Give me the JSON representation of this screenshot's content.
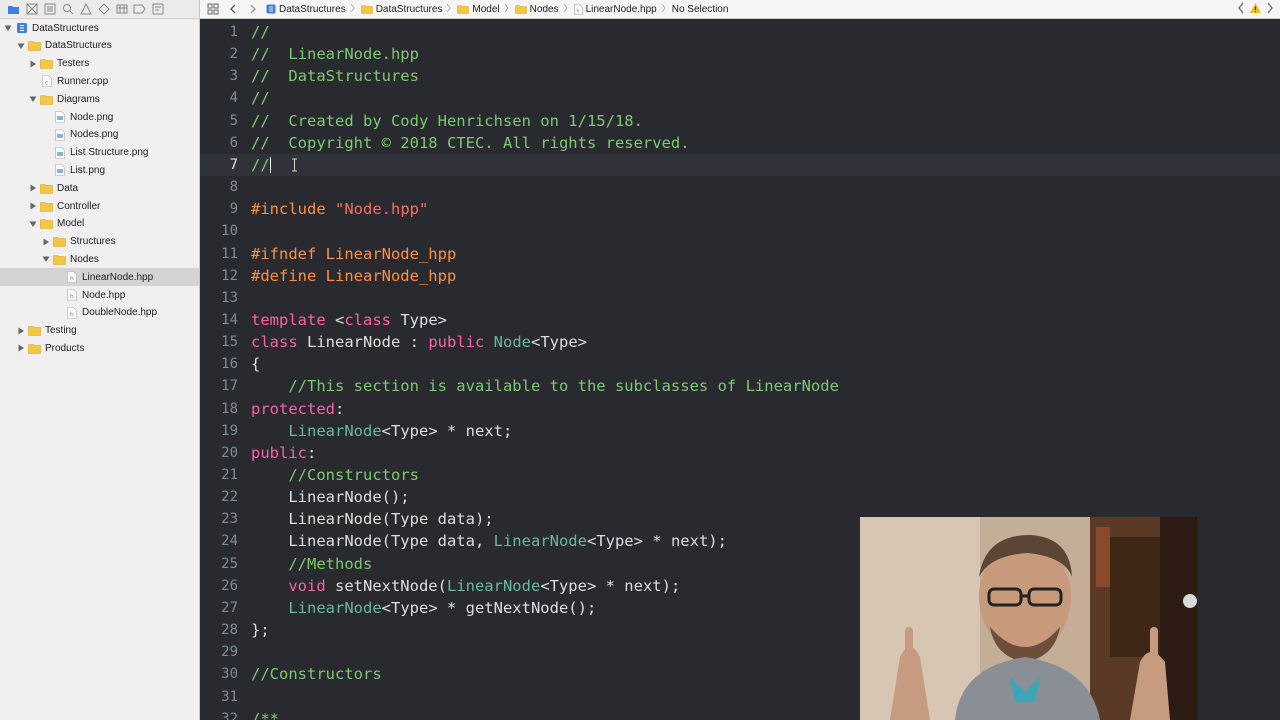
{
  "navigator": {
    "tree": [
      {
        "label": "DataStructures",
        "level": 0,
        "kind": "project",
        "disclosure": "open"
      },
      {
        "label": "DataStructures",
        "level": 1,
        "kind": "folder",
        "disclosure": "open"
      },
      {
        "label": "Testers",
        "level": 2,
        "kind": "folder",
        "disclosure": "closed"
      },
      {
        "label": "Runner.cpp",
        "level": 2,
        "kind": "cpp-file",
        "disclosure": "none"
      },
      {
        "label": "Diagrams",
        "level": 2,
        "kind": "folder",
        "disclosure": "open"
      },
      {
        "label": "Node.png",
        "level": 3,
        "kind": "image-file",
        "disclosure": "none"
      },
      {
        "label": "Nodes.png",
        "level": 3,
        "kind": "image-file",
        "disclosure": "none"
      },
      {
        "label": "List Structure.png",
        "level": 3,
        "kind": "image-file",
        "disclosure": "none"
      },
      {
        "label": "List.png",
        "level": 3,
        "kind": "image-file",
        "disclosure": "none"
      },
      {
        "label": "Data",
        "level": 2,
        "kind": "folder",
        "disclosure": "closed"
      },
      {
        "label": "Controller",
        "level": 2,
        "kind": "folder",
        "disclosure": "closed"
      },
      {
        "label": "Model",
        "level": 2,
        "kind": "folder",
        "disclosure": "open"
      },
      {
        "label": "Structures",
        "level": 3,
        "kind": "folder",
        "disclosure": "closed"
      },
      {
        "label": "Nodes",
        "level": 3,
        "kind": "folder",
        "disclosure": "open"
      },
      {
        "label": "LinearNode.hpp",
        "level": 4,
        "kind": "header-file",
        "disclosure": "none",
        "selected": true
      },
      {
        "label": "Node.hpp",
        "level": 4,
        "kind": "header-file",
        "disclosure": "none"
      },
      {
        "label": "DoubleNode.hpp",
        "level": 4,
        "kind": "header-file",
        "disclosure": "none"
      },
      {
        "label": "Testing",
        "level": 1,
        "kind": "folder",
        "disclosure": "closed"
      },
      {
        "label": "Products",
        "level": 1,
        "kind": "folder",
        "disclosure": "closed"
      }
    ]
  },
  "breadcrumb": [
    {
      "label": "DataStructures",
      "icon": "project-icon"
    },
    {
      "label": "DataStructures",
      "icon": "folder-icon"
    },
    {
      "label": "Model",
      "icon": "folder-icon"
    },
    {
      "label": "Nodes",
      "icon": "folder-icon"
    },
    {
      "label": "LinearNode.hpp",
      "icon": "header-file-icon"
    },
    {
      "label": "No Selection",
      "icon": ""
    }
  ],
  "editor": {
    "current_line": 7,
    "lines": [
      {
        "n": "1",
        "tokens": [
          {
            "t": "//",
            "c": "com"
          }
        ]
      },
      {
        "n": "2",
        "tokens": [
          {
            "t": "//  LinearNode.hpp",
            "c": "com"
          }
        ]
      },
      {
        "n": "3",
        "tokens": [
          {
            "t": "//  DataStructures",
            "c": "com"
          }
        ]
      },
      {
        "n": "4",
        "tokens": [
          {
            "t": "//",
            "c": "com"
          }
        ]
      },
      {
        "n": "5",
        "tokens": [
          {
            "t": "//  Created by Cody Henrichsen on 1/15/18.",
            "c": "com"
          }
        ]
      },
      {
        "n": "6",
        "tokens": [
          {
            "t": "//  Copyright © 2018 CTEC. All rights reserved.",
            "c": "com"
          }
        ]
      },
      {
        "n": "7",
        "tokens": [
          {
            "t": "//",
            "c": "com"
          }
        ]
      },
      {
        "n": "8",
        "tokens": []
      },
      {
        "n": "9",
        "tokens": [
          {
            "t": "#include ",
            "c": "pre"
          },
          {
            "t": "\"Node.hpp\"",
            "c": "str"
          }
        ]
      },
      {
        "n": "10",
        "tokens": []
      },
      {
        "n": "11",
        "tokens": [
          {
            "t": "#ifndef LinearNode_hpp",
            "c": "pre"
          }
        ]
      },
      {
        "n": "12",
        "tokens": [
          {
            "t": "#define LinearNode_hpp",
            "c": "pre"
          }
        ]
      },
      {
        "n": "13",
        "tokens": []
      },
      {
        "n": "14",
        "tokens": [
          {
            "t": "template",
            "c": "kw"
          },
          {
            "t": " <",
            "c": "plain"
          },
          {
            "t": "class",
            "c": "kw"
          },
          {
            "t": " Type>",
            "c": "plain"
          }
        ]
      },
      {
        "n": "15",
        "tokens": [
          {
            "t": "class",
            "c": "kw"
          },
          {
            "t": " LinearNode : ",
            "c": "plain"
          },
          {
            "t": "public",
            "c": "kw"
          },
          {
            "t": " ",
            "c": "plain"
          },
          {
            "t": "Node",
            "c": "type"
          },
          {
            "t": "<Type>",
            "c": "plain"
          }
        ]
      },
      {
        "n": "16",
        "tokens": [
          {
            "t": "{",
            "c": "plain"
          }
        ]
      },
      {
        "n": "17",
        "tokens": [
          {
            "t": "    //This section is available to the subclasses of LinearNode",
            "c": "com"
          }
        ]
      },
      {
        "n": "18",
        "tokens": [
          {
            "t": "protected",
            "c": "kw"
          },
          {
            "t": ":",
            "c": "plain"
          }
        ]
      },
      {
        "n": "19",
        "tokens": [
          {
            "t": "    ",
            "c": "plain"
          },
          {
            "t": "LinearNode",
            "c": "type"
          },
          {
            "t": "<Type> * next;",
            "c": "plain"
          }
        ]
      },
      {
        "n": "20",
        "tokens": [
          {
            "t": "public",
            "c": "kw"
          },
          {
            "t": ":",
            "c": "plain"
          }
        ]
      },
      {
        "n": "21",
        "tokens": [
          {
            "t": "    //Constructors",
            "c": "com"
          }
        ]
      },
      {
        "n": "22",
        "tokens": [
          {
            "t": "    LinearNode();",
            "c": "plain"
          }
        ]
      },
      {
        "n": "23",
        "tokens": [
          {
            "t": "    LinearNode(Type data);",
            "c": "plain"
          }
        ]
      },
      {
        "n": "24",
        "tokens": [
          {
            "t": "    LinearNode(Type data, ",
            "c": "plain"
          },
          {
            "t": "LinearNode",
            "c": "type"
          },
          {
            "t": "<Type> * next);",
            "c": "plain"
          }
        ]
      },
      {
        "n": "25",
        "tokens": [
          {
            "t": "    //Methods",
            "c": "com"
          }
        ]
      },
      {
        "n": "26",
        "tokens": [
          {
            "t": "    ",
            "c": "plain"
          },
          {
            "t": "void",
            "c": "kw"
          },
          {
            "t": " setNextNode(",
            "c": "plain"
          },
          {
            "t": "LinearNode",
            "c": "type"
          },
          {
            "t": "<Type> * next);",
            "c": "plain"
          }
        ]
      },
      {
        "n": "27",
        "tokens": [
          {
            "t": "    ",
            "c": "plain"
          },
          {
            "t": "LinearNode",
            "c": "type"
          },
          {
            "t": "<Type> * getNextNode();",
            "c": "plain"
          }
        ]
      },
      {
        "n": "28",
        "tokens": [
          {
            "t": "};",
            "c": "plain"
          }
        ]
      },
      {
        "n": "29",
        "tokens": []
      },
      {
        "n": "30",
        "tokens": [
          {
            "t": "//Constructors",
            "c": "com"
          }
        ]
      },
      {
        "n": "31",
        "tokens": []
      },
      {
        "n": "32",
        "tokens": [
          {
            "t": "/**",
            "c": "com"
          }
        ]
      }
    ]
  },
  "colors": {
    "editor_bg": "#292a30",
    "comment": "#7ec96f",
    "keyword": "#fc5fa3",
    "string": "#fc6a5d",
    "type": "#67b7a4",
    "preprocessor": "#fd8f3f",
    "plain": "#dfdfe0",
    "selected_row": "#d5d3d6",
    "folder": "#f3c744"
  }
}
